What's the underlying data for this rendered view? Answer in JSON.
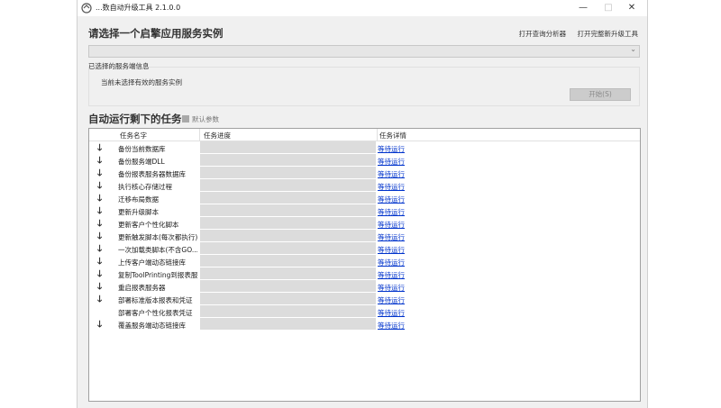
{
  "window": {
    "title": "...数自动升级工具 2.1.0.0",
    "minimize_icon": "—",
    "maximize_icon": "□",
    "close_icon": "✕"
  },
  "header": {
    "title": "请选择一个启擎应用服务实例"
  },
  "toplinks": {
    "open_analyzer": "打开查询分析器",
    "open_full_upgrade": "打开完整新升级工具"
  },
  "instance_select": {
    "value": ""
  },
  "info": {
    "legend": "已选择的服务端信息",
    "message": "当前未选择有效的服务实例",
    "start_button": "开始(S)"
  },
  "tasks": {
    "title": "自动运行剩下的任务",
    "default_params": "默认参数",
    "columns": [
      "任务名字",
      "任务进度",
      "任务详情"
    ],
    "items": [
      {
        "name": "备份当前数据库",
        "detail": "等待运行",
        "arrow": true
      },
      {
        "name": "备份服务端DLL",
        "detail": "等待运行",
        "arrow": true
      },
      {
        "name": "备份报表服务器数据库",
        "detail": "等待运行",
        "arrow": true
      },
      {
        "name": "执行核心存储过程",
        "detail": "等待运行",
        "arrow": true
      },
      {
        "name": "迁移布局数据",
        "detail": "等待运行",
        "arrow": true
      },
      {
        "name": "更新升级脚本",
        "detail": "等待运行",
        "arrow": true
      },
      {
        "name": "更新客户个性化脚本",
        "detail": "等待运行",
        "arrow": true
      },
      {
        "name": "更新触发脚本(每次都执行)",
        "detail": "等待运行",
        "arrow": true
      },
      {
        "name": "一次加载类脚本(不含GO...",
        "detail": "等待运行",
        "arrow": true
      },
      {
        "name": "上传客户端动态链接库",
        "detail": "等待运行",
        "arrow": true
      },
      {
        "name": "复制ToolPrinting到报表服...",
        "detail": "等待运行",
        "arrow": true
      },
      {
        "name": "重启报表服务器",
        "detail": "等待运行",
        "arrow": true
      },
      {
        "name": "部署标准版本报表和凭证",
        "detail": "等待运行",
        "arrow": true
      },
      {
        "name": "部署客户个性化报表凭证",
        "detail": "等待运行",
        "arrow": false
      },
      {
        "name": "覆盖服务端动态链接库",
        "detail": "等待运行",
        "arrow": true
      }
    ]
  }
}
